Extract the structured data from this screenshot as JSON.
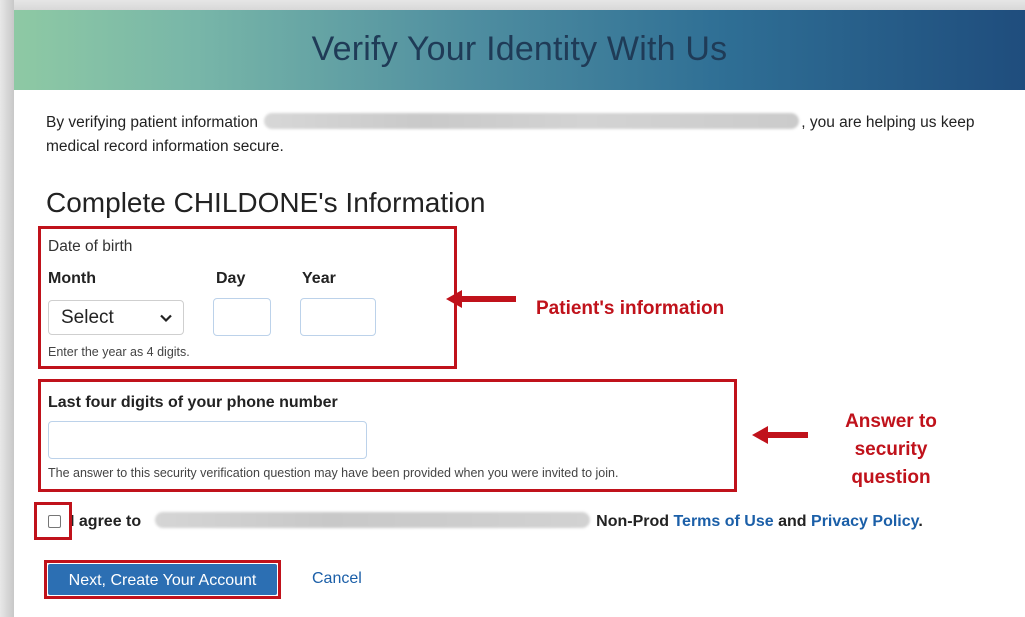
{
  "banner": {
    "title": "Verify Your Identity With Us"
  },
  "intro": {
    "before_blur": "By verifying patient information ",
    "after_blur": ", you are helping us keep medical record information secure."
  },
  "section": {
    "title": "Complete CHILDONE's Information"
  },
  "dob": {
    "label": "Date of birth",
    "month_label": "Month",
    "day_label": "Day",
    "year_label": "Year",
    "month_selected": "Select",
    "hint": "Enter the year as 4 digits."
  },
  "phone": {
    "label": "Last four digits of your phone number",
    "hint": "The answer to this security verification question may have been provided when you were invited to join."
  },
  "agree": {
    "prefix": "I agree to",
    "non_prod": "Non-Prod",
    "terms_link": "Terms of Use",
    "and": "and",
    "privacy_link": "Privacy Policy",
    "period": "."
  },
  "actions": {
    "next_label": "Next, Create Your Account",
    "cancel_label": "Cancel"
  },
  "annotations": {
    "patient_info": "Patient's information",
    "security_answer": "Answer to security question"
  },
  "colors": {
    "annotation_red": "#c0121b",
    "primary_button": "#2c6fb3",
    "link": "#1b5fa8"
  },
  "icons": [
    "chevron-down-icon",
    "arrow-left-icon"
  ]
}
